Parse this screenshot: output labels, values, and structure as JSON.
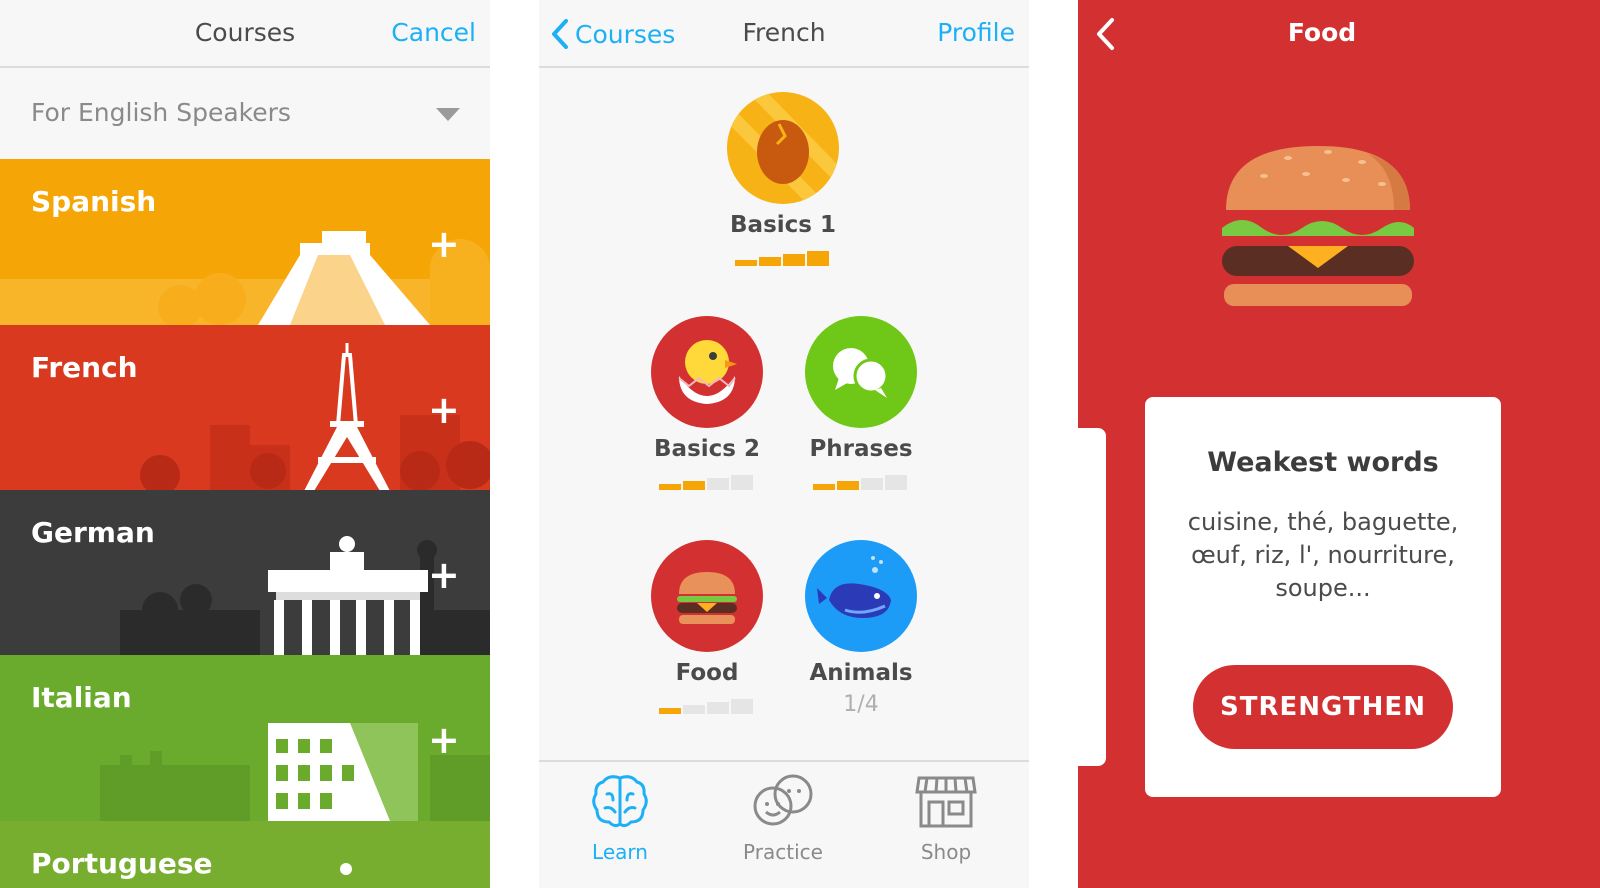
{
  "courses_screen": {
    "title": "Courses",
    "cancel_label": "Cancel",
    "language_filter": "For English Speakers",
    "plus_icon": "+",
    "courses": [
      {
        "name": "Spanish",
        "color": "#f5a506"
      },
      {
        "name": "French",
        "color": "#d8391f"
      },
      {
        "name": "German",
        "color": "#3c3c3c"
      },
      {
        "name": "Italian",
        "color": "#6aab2e"
      },
      {
        "name": "Portuguese",
        "color": "#78ae2f"
      }
    ]
  },
  "tree_screen": {
    "back_label": "Courses",
    "title": "French",
    "profile_label": "Profile",
    "skills": [
      {
        "label": "Basics 1",
        "icon": "egg-icon",
        "color": "#f7b216",
        "strength": 4
      },
      {
        "label": "Basics 2",
        "icon": "chick-icon",
        "color": "#d33131",
        "strength": 2
      },
      {
        "label": "Phrases",
        "icon": "speech-bubbles-icon",
        "color": "#6fc817",
        "strength": 2
      },
      {
        "label": "Food",
        "icon": "burger-icon",
        "color": "#d33131",
        "strength": 1
      },
      {
        "label": "Animals",
        "icon": "whale-icon",
        "color": "#1c9cf6",
        "progress": "1/4"
      }
    ],
    "tabs": [
      {
        "label": "Learn",
        "icon": "brain-icon",
        "active": true
      },
      {
        "label": "Practice",
        "icon": "faces-icon",
        "active": false
      },
      {
        "label": "Shop",
        "icon": "store-icon",
        "active": false
      }
    ],
    "colors": {
      "accent": "#1cb0f6",
      "meter_fill": "#f5a506",
      "meter_empty": "#e5e5e5"
    }
  },
  "skill_screen": {
    "title": "Food",
    "card_title": "Weakest words",
    "words": "cuisine, thé, baguette, œuf, riz, l', nourriture, soupe...",
    "button_label": "STRENGTHEN",
    "background": "#d33131"
  }
}
